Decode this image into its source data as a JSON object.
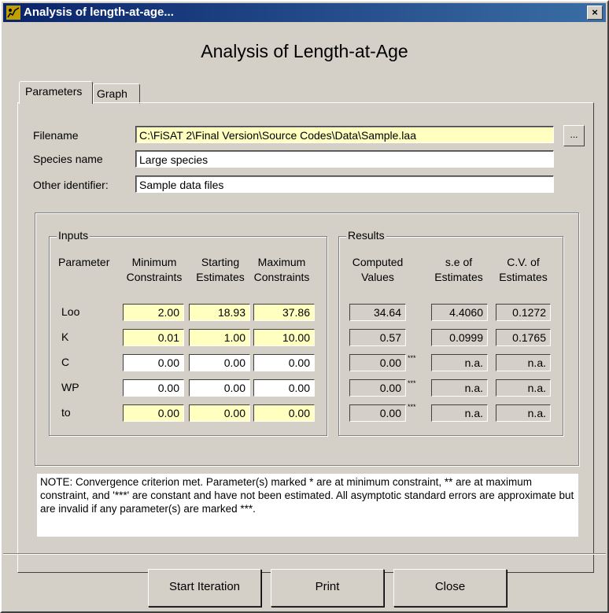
{
  "window": {
    "title": "Analysis of length-at-age...",
    "close_glyph": "×"
  },
  "heading": "Analysis of Length-at-Age",
  "tabs": [
    {
      "label": "Parameters"
    },
    {
      "label": "Graph"
    }
  ],
  "fields": {
    "filename_label": "Filename",
    "filename_value": "C:\\FiSAT 2\\Final Version\\Source Codes\\Data\\Sample.laa",
    "browse_label": "...",
    "species_label": "Species name",
    "species_value": "Large species",
    "other_label": "Other identifier:",
    "other_value": "Sample data files"
  },
  "inputs": {
    "group_title": "Inputs",
    "col_parameter": "Parameter",
    "col_min_1": "Minimum",
    "col_min_2": "Constraints",
    "col_start_1": "Starting",
    "col_start_2": "Estimates",
    "col_max_1": "Maximum",
    "col_max_2": "Constraints",
    "rows": [
      {
        "name": "Loo",
        "min": "2.00",
        "start": "18.93",
        "max": "37.86"
      },
      {
        "name": "K",
        "min": "0.01",
        "start": "1.00",
        "max": "10.00"
      },
      {
        "name": "C",
        "min": "0.00",
        "start": "0.00",
        "max": "0.00"
      },
      {
        "name": "WP",
        "min": "0.00",
        "start": "0.00",
        "max": "0.00"
      },
      {
        "name": "to",
        "min": "0.00",
        "start": "0.00",
        "max": "0.00"
      }
    ]
  },
  "results": {
    "group_title": "Results",
    "col_comp_1": "Computed",
    "col_comp_2": "Values",
    "col_se_1": "s.e of",
    "col_se_2": "Estimates",
    "col_cv_1": "C.V. of",
    "col_cv_2": "Estimates",
    "const_mark": "***",
    "rows": [
      {
        "computed": "34.64",
        "se": "4.4060",
        "cv": "0.1272"
      },
      {
        "computed": "0.57",
        "se": "0.0999",
        "cv": "0.1765"
      },
      {
        "computed": "0.00",
        "se": "n.a.",
        "cv": "n.a."
      },
      {
        "computed": "0.00",
        "se": "n.a.",
        "cv": "n.a."
      },
      {
        "computed": "0.00",
        "se": "n.a.",
        "cv": "n.a."
      }
    ]
  },
  "note": "NOTE: Convergence criterion met. Parameter(s) marked * are at minimum constraint, ** are at maximum constraint, and '***' are constant and have not been estimated. All asymptotic standard errors are approximate but are invalid if any parameter(s) are marked ***.",
  "buttons": {
    "start": "Start Iteration",
    "print": "Print",
    "close": "Close"
  },
  "colors": {
    "titlebar": "#0a246a",
    "face": "#d4d0c8",
    "highlight_field": "#ffffc0"
  }
}
